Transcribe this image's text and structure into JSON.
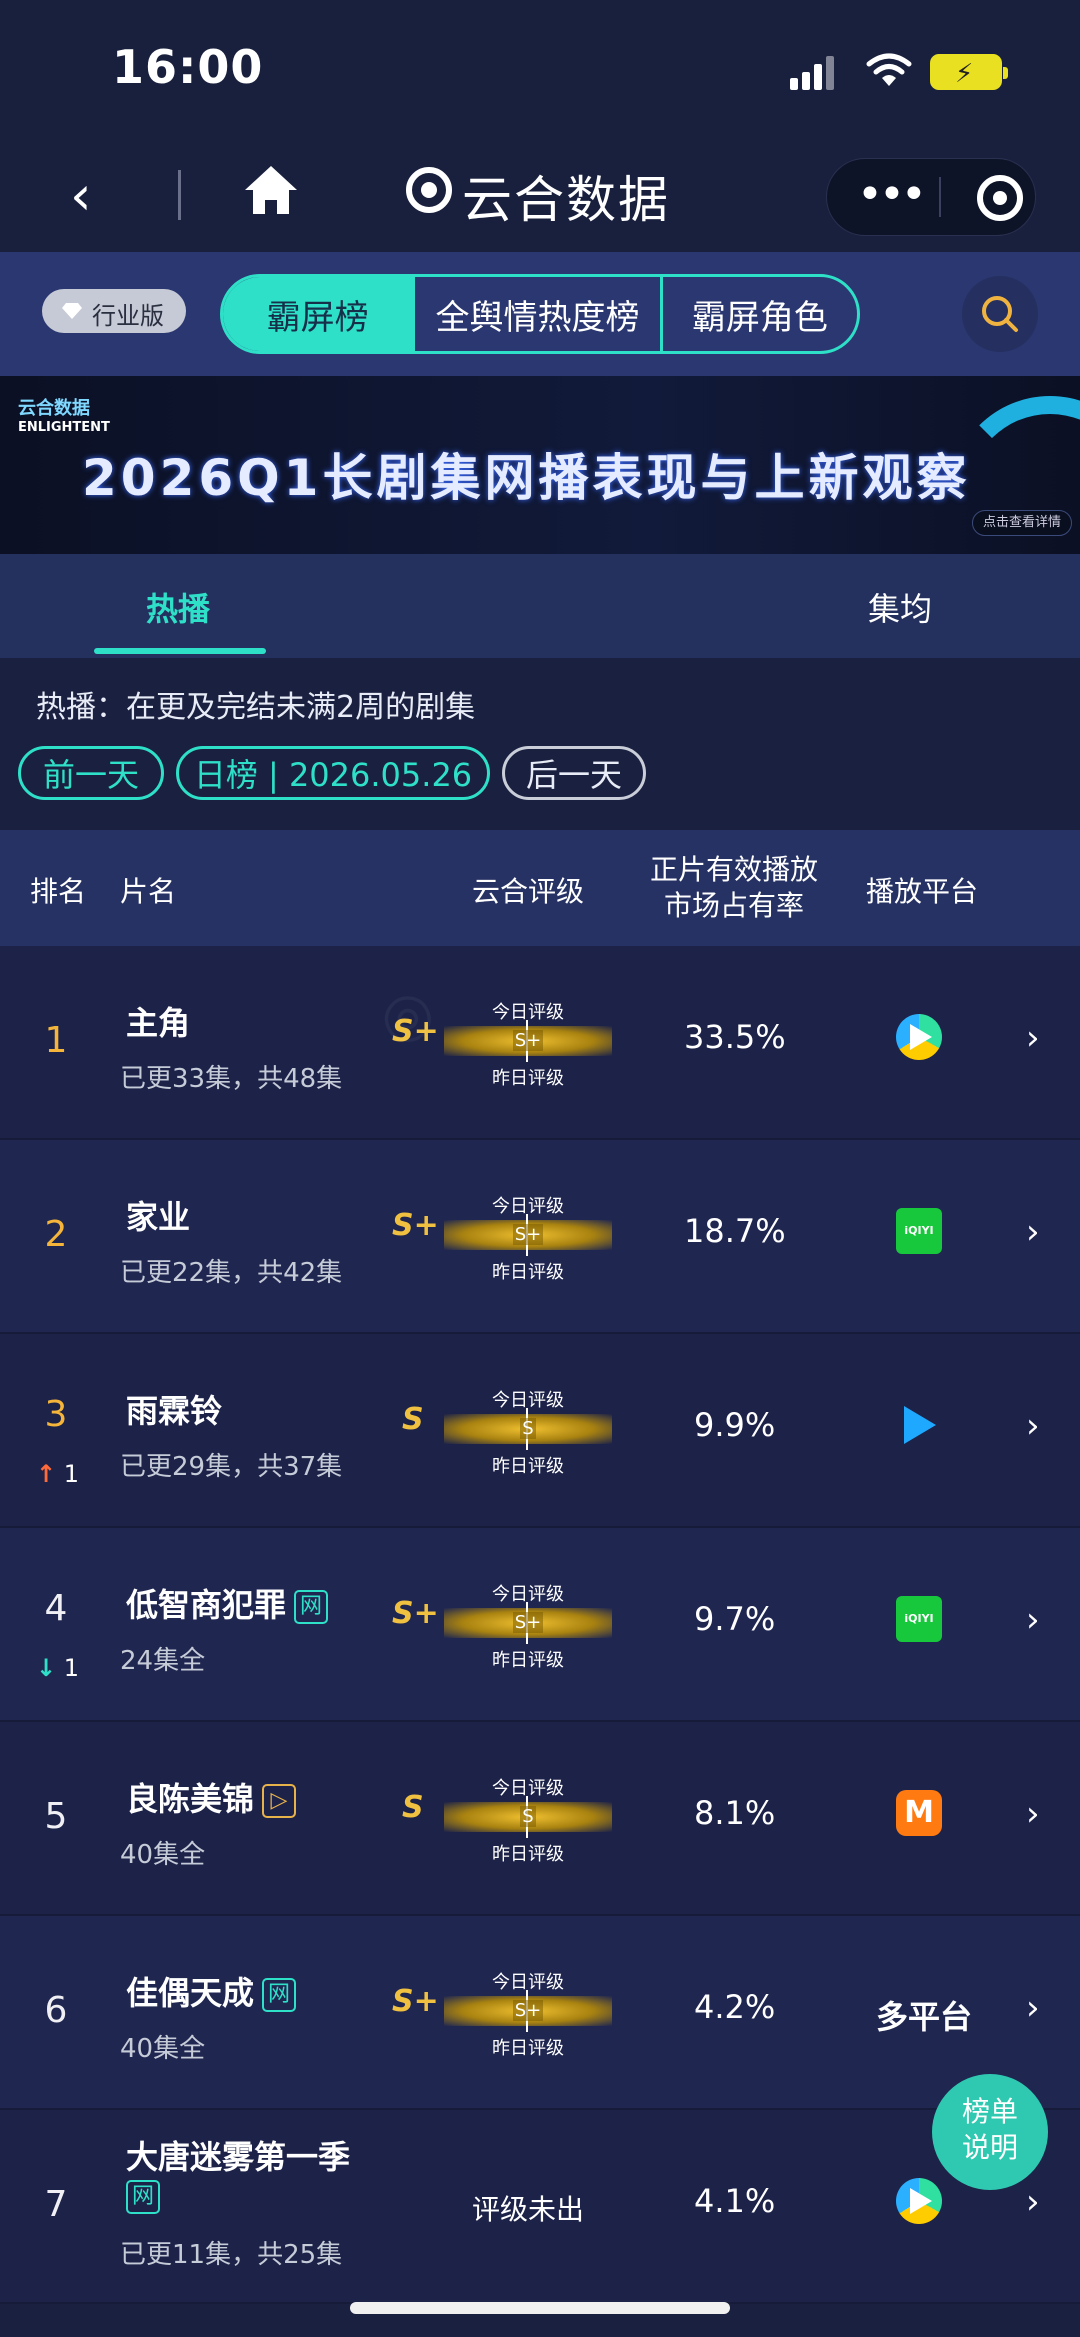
{
  "status": {
    "time": "16:00"
  },
  "nav": {
    "title": "云合数据"
  },
  "tabs": {
    "edition": "行业版",
    "segments": [
      "霸屏榜",
      "全舆情热度榜",
      "霸屏角色"
    ]
  },
  "banner": {
    "logo_cn": "云合数据",
    "logo_en": "ENLIGHTENT",
    "title": "2026Q1长剧集网播表现与上新观察",
    "button": "点击查看详情"
  },
  "subtabs": [
    "热播",
    "集均"
  ],
  "info": {
    "desc": "热播：在更及完结未满2周的剧集",
    "prev": "前一天",
    "current": "日榜 | 2026.05.26",
    "next": "后一天"
  },
  "table": {
    "headers": {
      "rank": "排名",
      "name": "片名",
      "grade": "云合评级",
      "share_line1": "正片有效播放",
      "share_line2": "市场占有率",
      "platform": "播放平台"
    },
    "grade_today": "今日评级",
    "grade_yday": "昨日评级",
    "grade_none": "评级未出",
    "rows": [
      {
        "rank": "1",
        "title": "主角",
        "episodes": "已更33集，共48集",
        "grade": "S+",
        "bar": "S+",
        "share": "33.5%",
        "platform": "tencent"
      },
      {
        "rank": "2",
        "title": "家业",
        "episodes": "已更22集，共42集",
        "grade": "S+",
        "bar": "S+",
        "share": "18.7%",
        "platform": "iqiyi"
      },
      {
        "rank": "3",
        "change": "1",
        "dir": "up",
        "title": "雨霖铃",
        "episodes": "已更29集，共37集",
        "grade": "S",
        "bar": "S",
        "share": "9.9%",
        "platform": "youku"
      },
      {
        "rank": "4",
        "change": "1",
        "dir": "down",
        "title": "低智商犯罪",
        "tag": "网",
        "episodes": "24集全",
        "grade": "S+",
        "bar": "S+",
        "share": "9.7%",
        "platform": "iqiyi"
      },
      {
        "rank": "5",
        "title": "良陈美锦",
        "tag": "▷",
        "episodes": "40集全",
        "grade": "S",
        "bar": "S",
        "share": "8.1%",
        "platform": "mango"
      },
      {
        "rank": "6",
        "title": "佳偶天成",
        "tag": "网",
        "episodes": "40集全",
        "grade": "S+",
        "bar": "S+",
        "share": "4.2%",
        "platform_text": "多平台"
      },
      {
        "rank": "7",
        "title": "大唐迷雾第一季",
        "tag": "网",
        "episodes": "已更11集，共25集",
        "share": "4.1%",
        "platform": "tencent"
      }
    ]
  },
  "platform_labels": {
    "iqiyi": "iQIYI",
    "mango": "M"
  },
  "float_button": {
    "line1": "榜单",
    "line2": "说明"
  },
  "colors": {
    "accent": "#2fe0c8",
    "gold": "#f0c040",
    "bg": "#1a2040"
  }
}
